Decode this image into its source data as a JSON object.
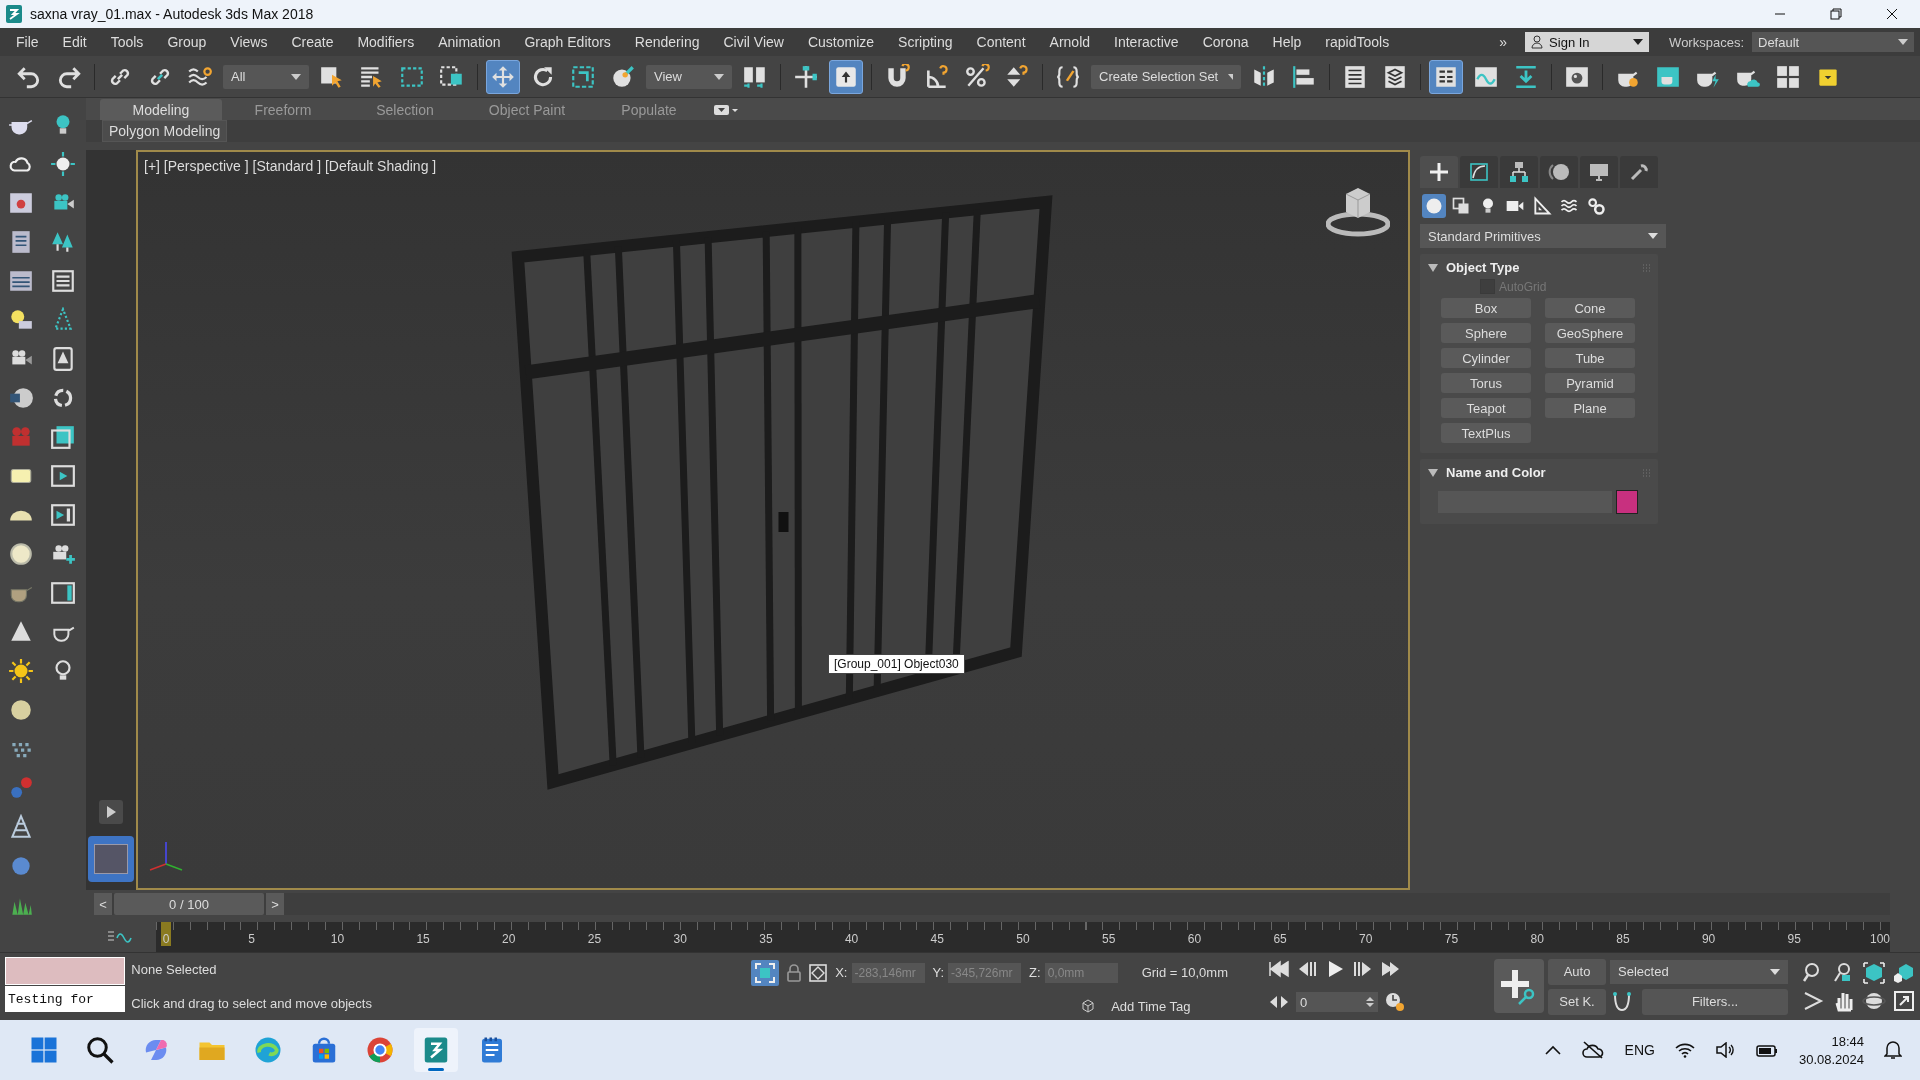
{
  "window": {
    "title": "saxna vray_01.max - Autodesk 3ds Max 2018"
  },
  "menu": [
    "File",
    "Edit",
    "Tools",
    "Group",
    "Views",
    "Create",
    "Modifiers",
    "Animation",
    "Graph Editors",
    "Rendering",
    "Civil View",
    "Customize",
    "Scripting",
    "Content",
    "Arnold",
    "Interactive",
    "Corona",
    "Help",
    "rapidTools"
  ],
  "menu_overflow": "»",
  "sign_in": "Sign In",
  "workspaces": {
    "label": "Workspaces:",
    "value": "Default"
  },
  "toolbar": [
    {
      "kind": "undo",
      "selected": false
    },
    {
      "kind": "redo",
      "selected": false
    },
    {
      "kind": "separator"
    },
    {
      "kind": "link",
      "selected": false
    },
    {
      "kind": "unlink",
      "selected": false
    },
    {
      "kind": "bind",
      "selected": false
    },
    {
      "kind": "dropdown",
      "value": "All"
    },
    {
      "kind": "select",
      "selected": false
    },
    {
      "kind": "select-by-name",
      "selected": false
    },
    {
      "kind": "region",
      "selected": false
    },
    {
      "kind": "crossing",
      "selected": false
    },
    {
      "kind": "separator"
    },
    {
      "kind": "move",
      "selected": true
    },
    {
      "kind": "rotate",
      "selected": false
    },
    {
      "kind": "scale",
      "selected": false
    },
    {
      "kind": "placement",
      "selected": false
    },
    {
      "kind": "dropdown",
      "value": "View"
    },
    {
      "kind": "pivot",
      "selected": false
    },
    {
      "kind": "separator"
    },
    {
      "kind": "manipulate",
      "selected": false
    },
    {
      "kind": "keyboard",
      "selected": true
    },
    {
      "kind": "separator"
    },
    {
      "kind": "snap",
      "selected": false
    },
    {
      "kind": "angle-snap",
      "selected": false
    },
    {
      "kind": "percent-snap",
      "selected": false
    },
    {
      "kind": "spinner-snap",
      "selected": false
    },
    {
      "kind": "separator"
    },
    {
      "kind": "named-sets",
      "selected": false
    },
    {
      "kind": "selection-set-dropdown",
      "value": "Create Selection Set"
    },
    {
      "kind": "mirror",
      "selected": false
    },
    {
      "kind": "align",
      "selected": false
    },
    {
      "kind": "separator"
    },
    {
      "kind": "scene-explorer",
      "selected": false
    },
    {
      "kind": "layers",
      "selected": false
    },
    {
      "kind": "separator"
    },
    {
      "kind": "ribbon",
      "selected": true
    },
    {
      "kind": "curve-editor",
      "selected": false
    },
    {
      "kind": "schematic",
      "selected": false
    },
    {
      "kind": "separator"
    },
    {
      "kind": "material-editor",
      "selected": false
    },
    {
      "kind": "separator"
    },
    {
      "kind": "render-setup",
      "selected": false
    },
    {
      "kind": "rendered-frame",
      "selected": false
    },
    {
      "kind": "render",
      "selected": false
    },
    {
      "kind": "render-cloud",
      "selected": false
    },
    {
      "kind": "image-grid",
      "selected": false
    },
    {
      "kind": "folder",
      "selected": false
    }
  ],
  "ribbon": {
    "tabs": [
      {
        "label": "Modeling",
        "selected": true
      },
      {
        "label": "Freeform",
        "selected": false
      },
      {
        "label": "Selection",
        "selected": false
      },
      {
        "label": "Object Paint",
        "selected": false
      },
      {
        "label": "Populate",
        "selected": false
      }
    ],
    "panel": "Polygon Modeling"
  },
  "viewport": {
    "label": "[+] [Perspective ] [Standard ] [Default Shading ]",
    "tooltip": "[Group_001] Object030"
  },
  "command_panel": {
    "tabs": [
      {
        "kind": "create",
        "selected": true
      },
      {
        "kind": "modify",
        "selected": false
      },
      {
        "kind": "hierarchy",
        "selected": false
      },
      {
        "kind": "motion",
        "selected": false
      },
      {
        "kind": "display",
        "selected": false
      },
      {
        "kind": "utilities",
        "selected": false
      }
    ],
    "categories": [
      {
        "kind": "geometry",
        "selected": true
      },
      {
        "kind": "shapes",
        "selected": false
      },
      {
        "kind": "lights",
        "selected": false
      },
      {
        "kind": "cameras",
        "selected": false
      },
      {
        "kind": "helpers",
        "selected": false
      },
      {
        "kind": "space-warps",
        "selected": false
      },
      {
        "kind": "systems",
        "selected": false
      }
    ],
    "dropdown": "Standard Primitives",
    "object_type": {
      "title": "Object Type",
      "expanded": true,
      "autogrid": {
        "label": "AutoGrid",
        "checked": false,
        "disabled": true
      },
      "buttons": [
        "Box",
        "Cone",
        "Sphere",
        "GeoSphere",
        "Cylinder",
        "Tube",
        "Torus",
        "Pyramid",
        "Teapot",
        "Plane",
        "TextPlus"
      ]
    },
    "name_and_color": {
      "title": "Name and Color",
      "expanded": true,
      "color": "#c8307f"
    }
  },
  "time_slider": {
    "prev": "<",
    "label": "0 / 100",
    "next": ">",
    "level": 0
  },
  "ruler_labels": [
    "0",
    "5",
    "10",
    "15",
    "20",
    "25",
    "30",
    "35",
    "40",
    "45",
    "50",
    "55",
    "60",
    "65",
    "70",
    "75",
    "80",
    "85",
    "90",
    "95",
    "100"
  ],
  "status": {
    "listener": "Testing for",
    "selection": "None Selected",
    "prompt": "Click and drag to select and move objects",
    "coords": [
      {
        "axis": "X:",
        "value": "-283,146mr"
      },
      {
        "axis": "Y:",
        "value": "-345,726mr"
      },
      {
        "axis": "Z:",
        "value": "0,0mm"
      }
    ],
    "grid": "Grid = 10,0mm",
    "time_tag": "Add Time Tag",
    "frame": "0",
    "auto_key": "Auto",
    "set_key": "Set K.",
    "key_filter": "Selected",
    "filters": "Filters..."
  },
  "taskbar": {
    "apps": [
      {
        "kind": "start",
        "selected": false
      },
      {
        "kind": "search",
        "selected": false
      },
      {
        "kind": "copilot",
        "selected": false
      },
      {
        "kind": "explorer",
        "selected": false
      },
      {
        "kind": "edge",
        "selected": false
      },
      {
        "kind": "store",
        "selected": false
      },
      {
        "kind": "chrome",
        "selected": false
      },
      {
        "kind": "max",
        "selected": true
      },
      {
        "kind": "notepad",
        "selected": false
      }
    ],
    "language": "ENG",
    "time": "18:44",
    "date": "30.08.2024"
  }
}
